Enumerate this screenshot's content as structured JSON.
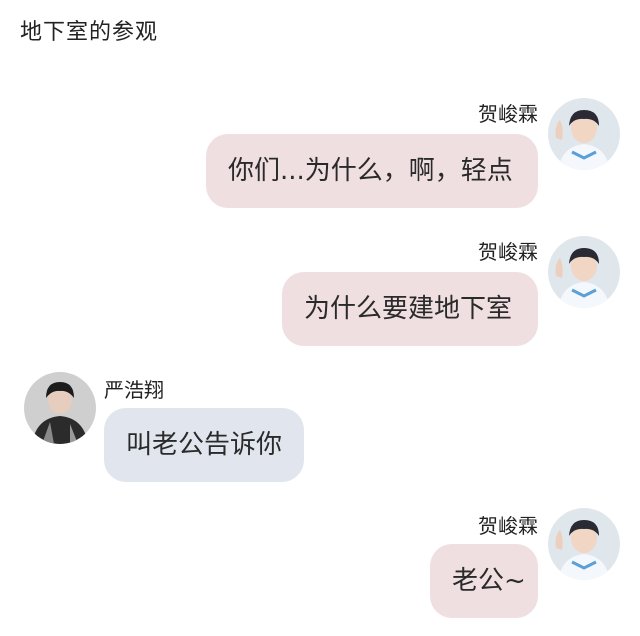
{
  "header": {
    "title": "地下室的参观"
  },
  "messages": [
    {
      "sender": "贺峻霖",
      "text": "你们...为什么，啊，轻点",
      "side": "right",
      "bubble_color": "#f0dfe1",
      "avatar_icon": "user-avatar-he"
    },
    {
      "sender": "贺峻霖",
      "text": "为什么要建地下室",
      "side": "right",
      "bubble_color": "#f0dfe1",
      "avatar_icon": "user-avatar-he"
    },
    {
      "sender": "严浩翔",
      "text": "叫老公告诉你",
      "side": "left",
      "bubble_color": "#e1e6ee",
      "avatar_icon": "user-avatar-yan"
    },
    {
      "sender": "贺峻霖",
      "text": "老公~",
      "side": "right",
      "bubble_color": "#f0dfe1",
      "avatar_icon": "user-avatar-he"
    }
  ]
}
